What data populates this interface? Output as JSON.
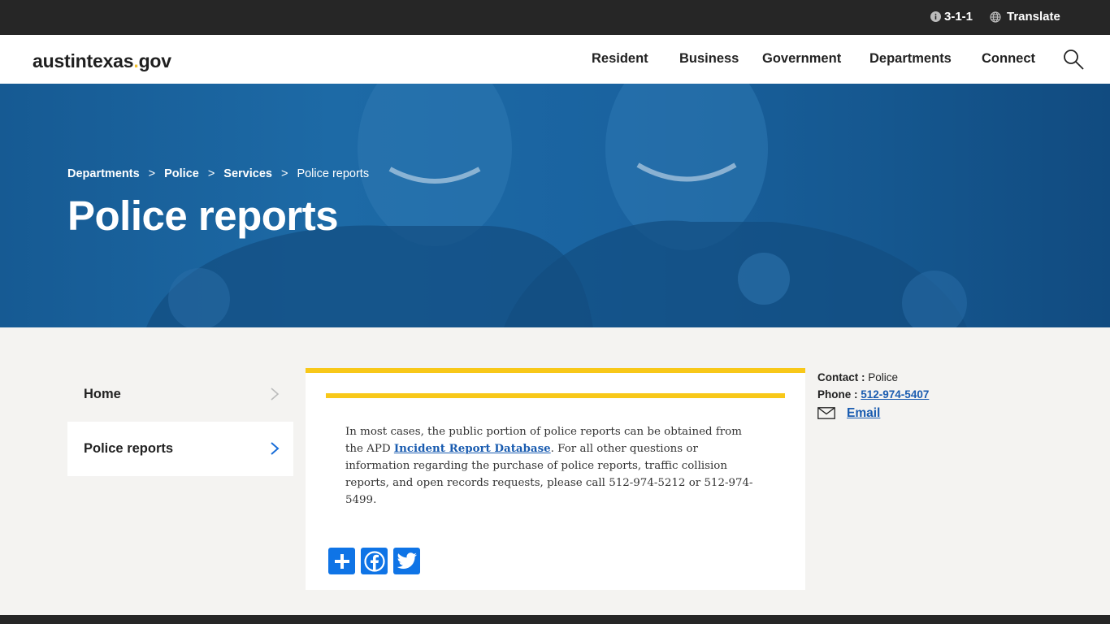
{
  "utility_bar": {
    "phone_311": "3-1-1",
    "translate": "Translate"
  },
  "header": {
    "logo_main": "austintexas",
    "logo_dot": ".",
    "logo_tld": "gov",
    "nav": [
      "Resident",
      "Business",
      "Government",
      "Departments",
      "Connect"
    ]
  },
  "hero": {
    "breadcrumb": [
      "Departments",
      "Police",
      "Services",
      "Police reports"
    ],
    "breadcrumb_separator": ">",
    "title": "Police reports"
  },
  "sidenav": {
    "items": [
      {
        "label": "Home",
        "active": false
      },
      {
        "label": "Police reports",
        "active": true
      }
    ]
  },
  "content": {
    "body_before": "In most cases, the public portion of police reports can be obtained from the APD ",
    "link_text": "Incident Report Database",
    "body_after": ". For all other questions or information regarding the purchase of police reports, traffic collision reports, and open records requests, please call 512-974-5212 or 512-974-5499.",
    "share_buttons": [
      "share-icon",
      "facebook-icon",
      "twitter-icon"
    ]
  },
  "contact": {
    "contact_label": "Contact :",
    "contact_value": "Police",
    "phone_label": "Phone :",
    "phone_value": "512-974-5407",
    "email_label": "Email"
  },
  "colors": {
    "accent_yellow": "#f8c819",
    "link_blue": "#1a5cb0",
    "hero_blue": "#1a63a0",
    "dark_bar": "#262626",
    "share_blue": "#0f74e6"
  }
}
